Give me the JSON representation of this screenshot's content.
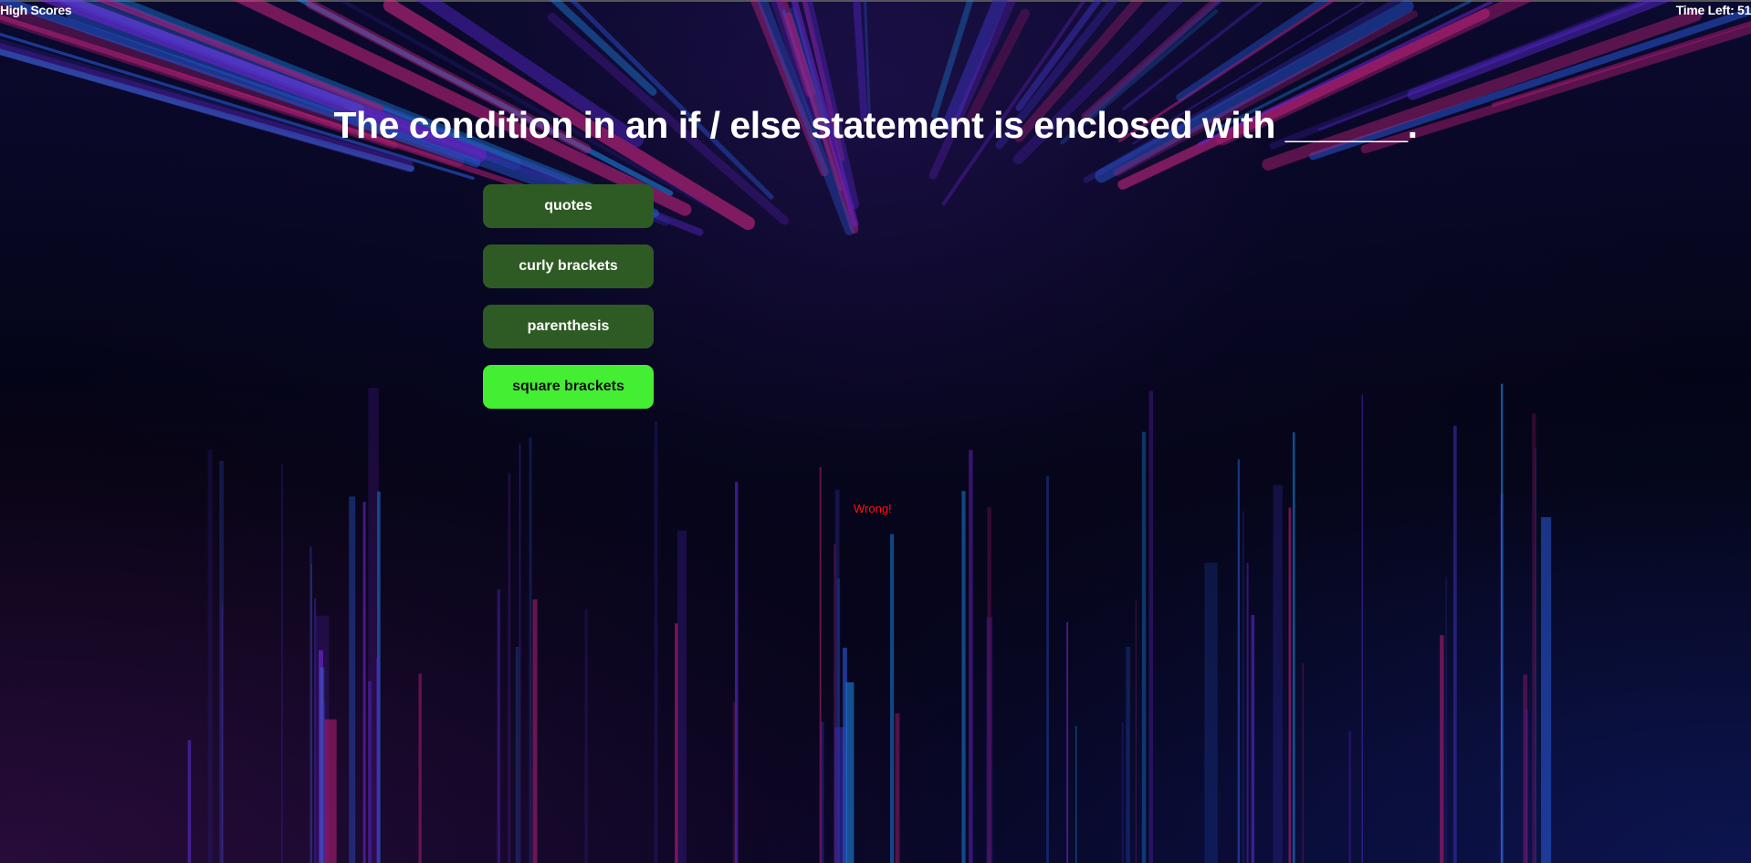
{
  "header": {
    "high_scores_label": "High Scores",
    "timer_text": "Time Left: 51"
  },
  "quiz": {
    "question": "The condition in an if / else statement is enclosed with ______.",
    "answers": [
      {
        "label": "quotes",
        "selected": false
      },
      {
        "label": "curly brackets",
        "selected": false
      },
      {
        "label": "parenthesis",
        "selected": false
      },
      {
        "label": "square brackets",
        "selected": true
      }
    ],
    "feedback": "Wrong!"
  },
  "colors": {
    "answer_default": "#2e5b24",
    "answer_selected": "#44ee33",
    "feedback": "#ff1111"
  }
}
